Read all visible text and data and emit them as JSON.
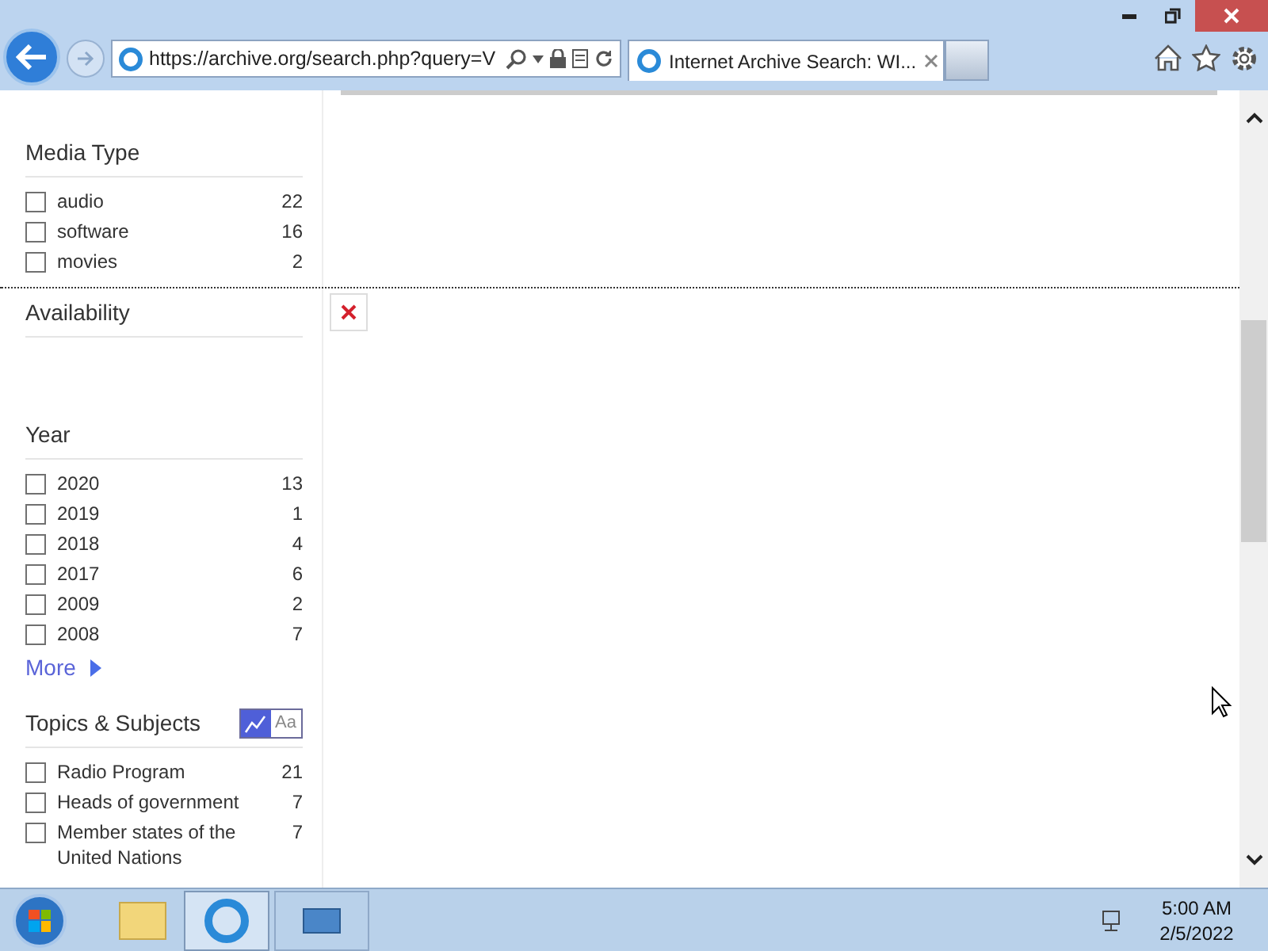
{
  "browser": {
    "address": "https://archive.org/search.php?query=V",
    "tab_title": "Internet Archive Search: WI..."
  },
  "sections": [
    {
      "title": "Media Type",
      "items": [
        {
          "label": "audio",
          "count": "22",
          "checked": false
        },
        {
          "label": "software",
          "count": "16",
          "checked": false
        },
        {
          "label": "movies",
          "count": "2",
          "checked": false
        }
      ]
    },
    {
      "title": "Availability"
    },
    {
      "title": "Year",
      "items": [
        {
          "label": "2020",
          "count": "13",
          "checked": false
        },
        {
          "label": "2019",
          "count": "1",
          "checked": false
        },
        {
          "label": "2018",
          "count": "4",
          "checked": false
        },
        {
          "label": "2017",
          "count": "6",
          "checked": false
        },
        {
          "label": "2009",
          "count": "2",
          "checked": false
        },
        {
          "label": "2008",
          "count": "7",
          "checked": false
        }
      ],
      "more": "More"
    },
    {
      "title": "Topics & Subjects",
      "toggle": {
        "text_label": "Aa",
        "chart_selected": true
      },
      "items": [
        {
          "label": "Radio Program",
          "count": "21",
          "checked": false
        },
        {
          "label": "Heads of government",
          "count": "7",
          "checked": false
        },
        {
          "label": "Member states of the United Nations",
          "count": "7",
          "checked": false
        }
      ]
    }
  ],
  "taskbar": {
    "time": "5:00 AM",
    "date": "2/5/2022"
  }
}
